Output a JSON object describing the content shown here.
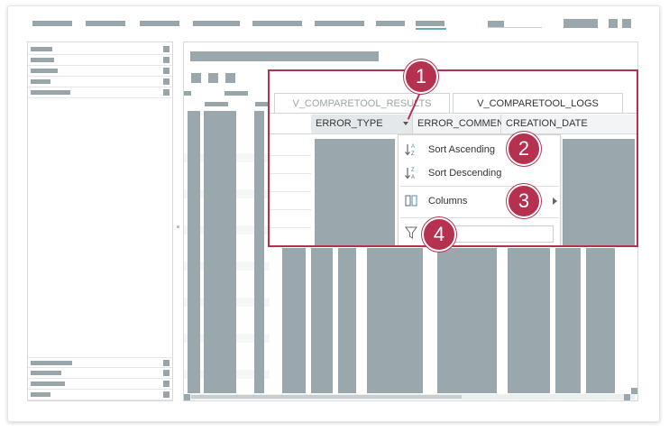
{
  "callout": {
    "tabs": [
      "V_COMPARETOOL_RESULTS",
      "V_COMPARETOOL_LOGS"
    ],
    "active_tab": "V_COMPARETOOL_LOGS",
    "columns": [
      "ERROR_TYPE",
      "ERROR_COMMENT",
      "CREATION_DATE"
    ],
    "selected_column": "ERROR_TYPE"
  },
  "context_menu": {
    "sort_ascending": "Sort Ascending",
    "sort_descending": "Sort Descending",
    "columns": "Columns",
    "filter_placeholder": ""
  },
  "badges": [
    "1",
    "2",
    "3",
    "4"
  ],
  "icons": {
    "sort_ascending": "sort-ascending-icon",
    "sort_descending": "sort-descending-icon",
    "columns": "columns-icon",
    "filter": "filter-icon",
    "dropdown": "dropdown-arrow-icon",
    "submenu": "submenu-arrow-icon"
  },
  "colors": {
    "accent": "#b5314f",
    "placeholder": "#9aa8ad",
    "active_underline": "#6aa9b6"
  }
}
